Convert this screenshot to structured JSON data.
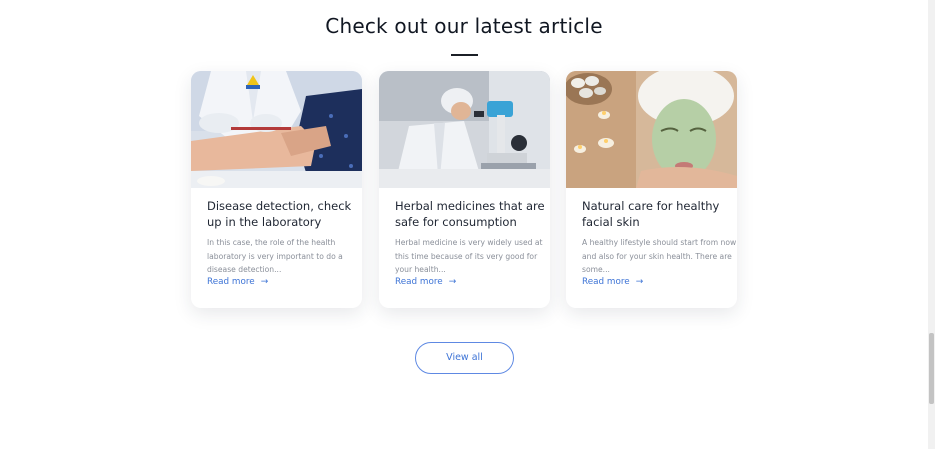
{
  "section": {
    "title": "Check out our latest article"
  },
  "articles": [
    {
      "title": "Disease detection, check up in the laboratory",
      "excerpt": "In this case, the role of the health laboratory is very important to do a disease detection...",
      "read_more": "Read more",
      "image": "laboratory-blood-test-photo"
    },
    {
      "title": "Herbal medicines that are safe for consumption",
      "excerpt": "Herbal medicine is very widely used at this time because of its very good for your health...",
      "read_more": "Read more",
      "image": "scientist-microscope-photo"
    },
    {
      "title": "Natural care for healthy facial skin",
      "excerpt": "A healthy lifestyle should start from now and also for your skin health. There are some...",
      "read_more": "Read more",
      "image": "facial-mask-spa-photo"
    }
  ],
  "view_all_label": "View all",
  "icons": {
    "read_more_arrow": "arrow-right-icon"
  },
  "colors": {
    "accent": "#3e74d6",
    "title": "#111722",
    "excerpt": "#8a8f99"
  }
}
